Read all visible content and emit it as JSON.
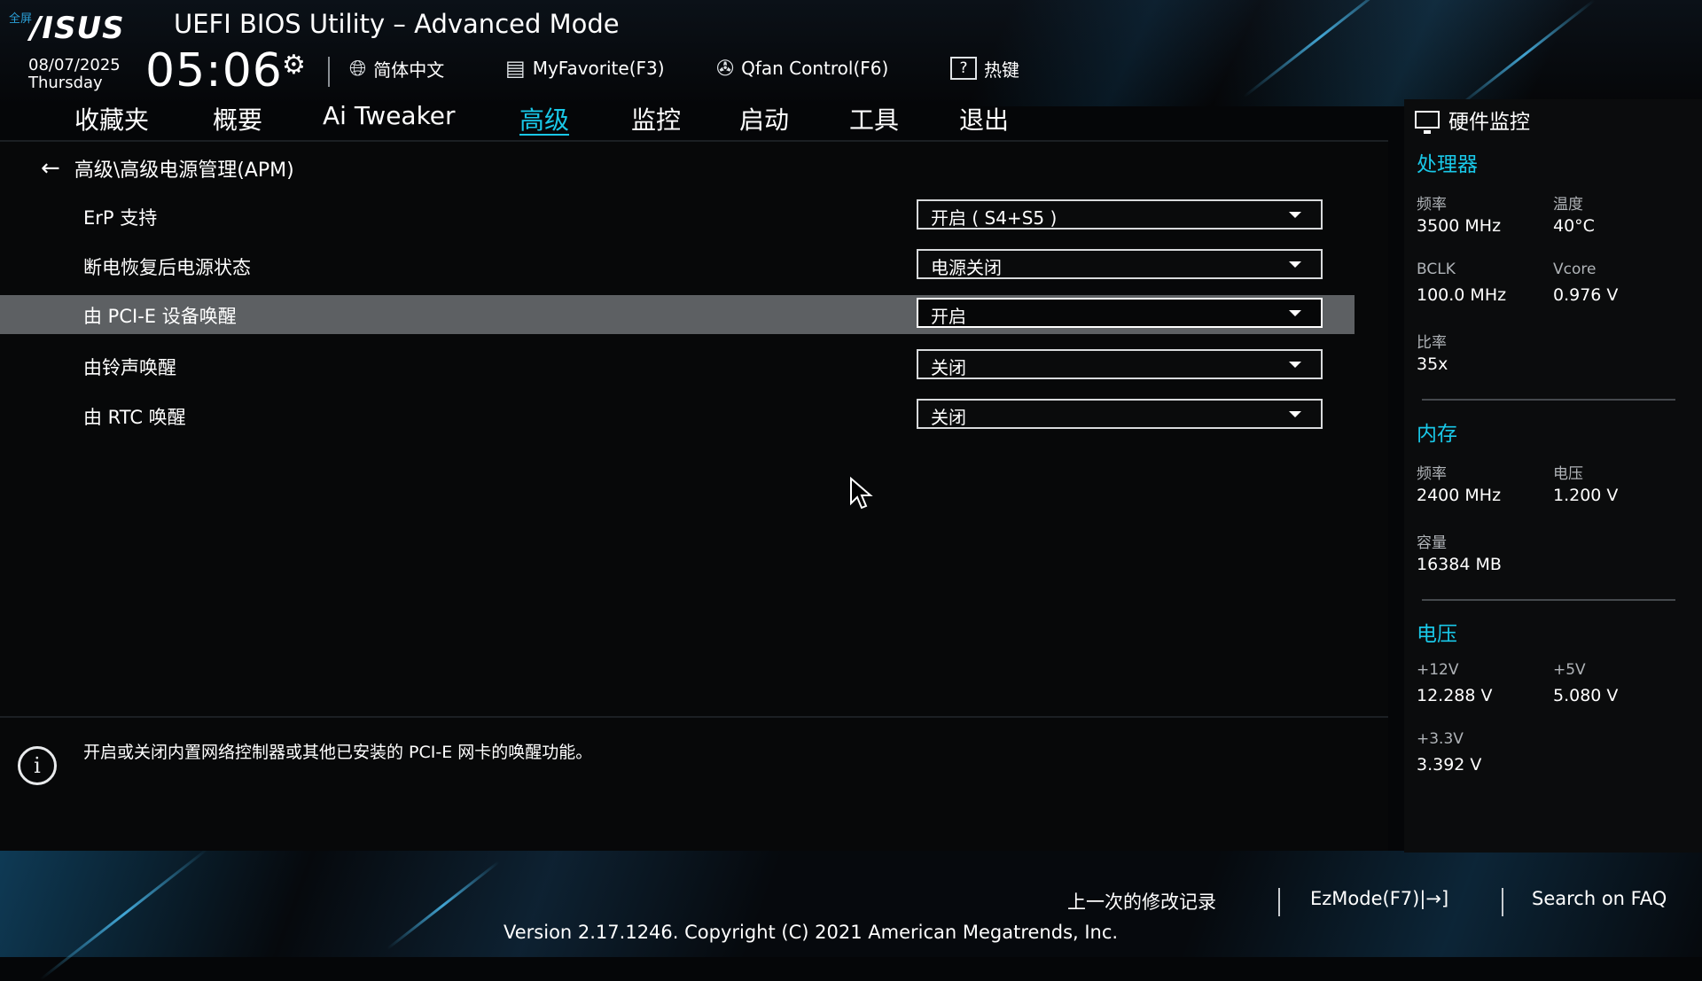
{
  "header": {
    "corner_tag": "全屏",
    "logo": "/ISUS",
    "title": "UEFI BIOS Utility – Advanced Mode",
    "date": "08/07/2025",
    "day": "Thursday",
    "time": "05:06",
    "settings_icon": "gear-icon"
  },
  "toolbar": {
    "language": "简体中文",
    "myfavorite": "MyFavorite(F3)",
    "qfan": "Qfan Control(F6)",
    "hotkeys": "热键",
    "hotkeys_icon_glyph": "?"
  },
  "tabs": [
    {
      "label": "收藏夹"
    },
    {
      "label": "概要"
    },
    {
      "label": "Ai Tweaker"
    },
    {
      "label": "高级"
    },
    {
      "label": "监控"
    },
    {
      "label": "启动"
    },
    {
      "label": "工具"
    },
    {
      "label": "退出"
    }
  ],
  "active_tab": "高级",
  "breadcrumb": "高级\\高级电源管理(APM)",
  "settings": [
    {
      "label": "ErP 支持",
      "value": "开启 ( S4+S5 )"
    },
    {
      "label": "断电恢复后电源状态",
      "value": "电源关闭"
    },
    {
      "label": "由 PCI-E 设备唤醒",
      "value": "开启"
    },
    {
      "label": "由铃声唤醒",
      "value": "关闭"
    },
    {
      "label": "由 RTC 唤醒",
      "value": "关闭"
    }
  ],
  "selected_setting": "由 PCI-E 设备唤醒",
  "help": {
    "icon_glyph": "i",
    "text": "开启或关闭内置网络控制器或其他已安装的 PCI-E 网卡的唤醒功能。"
  },
  "hw_monitor": {
    "title": "硬件监控",
    "cpu": {
      "title": "处理器",
      "freq_label": "频率",
      "freq_value": "3500 MHz",
      "temp_label": "温度",
      "temp_value": "40°C",
      "bclk_label": "BCLK",
      "bclk_value": "100.0 MHz",
      "vcore_label": "Vcore",
      "vcore_value": "0.976 V",
      "ratio_label": "比率",
      "ratio_value": "35x"
    },
    "memory": {
      "title": "内存",
      "freq_label": "频率",
      "freq_value": "2400 MHz",
      "volt_label": "电压",
      "volt_value": "1.200 V",
      "cap_label": "容量",
      "cap_value": "16384 MB"
    },
    "voltage": {
      "title": "电压",
      "v12_label": "+12V",
      "v12_value": "12.288 V",
      "v5_label": "+5V",
      "v5_value": "5.080 V",
      "v33_label": "+3.3V",
      "v33_value": "3.392 V"
    }
  },
  "footer": {
    "last_modified": "上一次的修改记录",
    "ezmode": "EzMode(F7)|→]",
    "search_faq": "Search on FAQ",
    "version": "Version 2.17.1246. Copyright (C) 2021 American Megatrends, Inc."
  },
  "colors": {
    "accent": "#19c8e8",
    "selected_row": "#5d6063",
    "background": "#050608"
  }
}
